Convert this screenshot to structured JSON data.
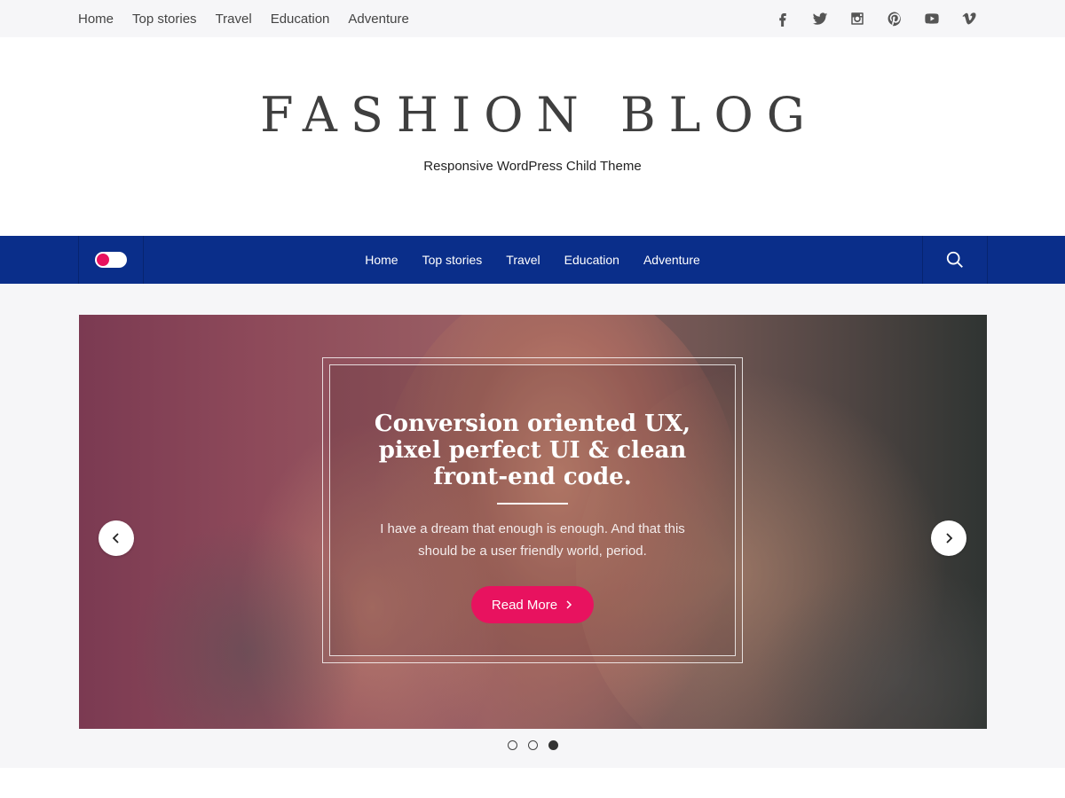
{
  "topbar": {
    "nav": [
      "Home",
      "Top stories",
      "Travel",
      "Education",
      "Adventure"
    ],
    "social_icons": [
      "facebook-icon",
      "twitter-icon",
      "instagram-icon",
      "pinterest-icon",
      "youtube-icon",
      "vimeo-icon"
    ]
  },
  "header": {
    "title": "FASHION BLOG",
    "tagline": "Responsive WordPress Child Theme"
  },
  "mainnav": {
    "items": [
      "Home",
      "Top stories",
      "Travel",
      "Education",
      "Adventure"
    ],
    "toggle_color": "#e8125f",
    "background": "#0a2e8a"
  },
  "slider": {
    "title_line1": "Conversion oriented UX,",
    "title_line2": "pixel perfect UI & clean",
    "title_line3": "front-end code.",
    "description_line1": "I have a dream that enough is enough. And that this",
    "description_line2": "should be a user friendly world, period.",
    "button_label": "Read More",
    "button_icon": "chevron-right-icon",
    "accent_color": "#e8125f",
    "dots_total": 3,
    "active_dot": 3
  }
}
